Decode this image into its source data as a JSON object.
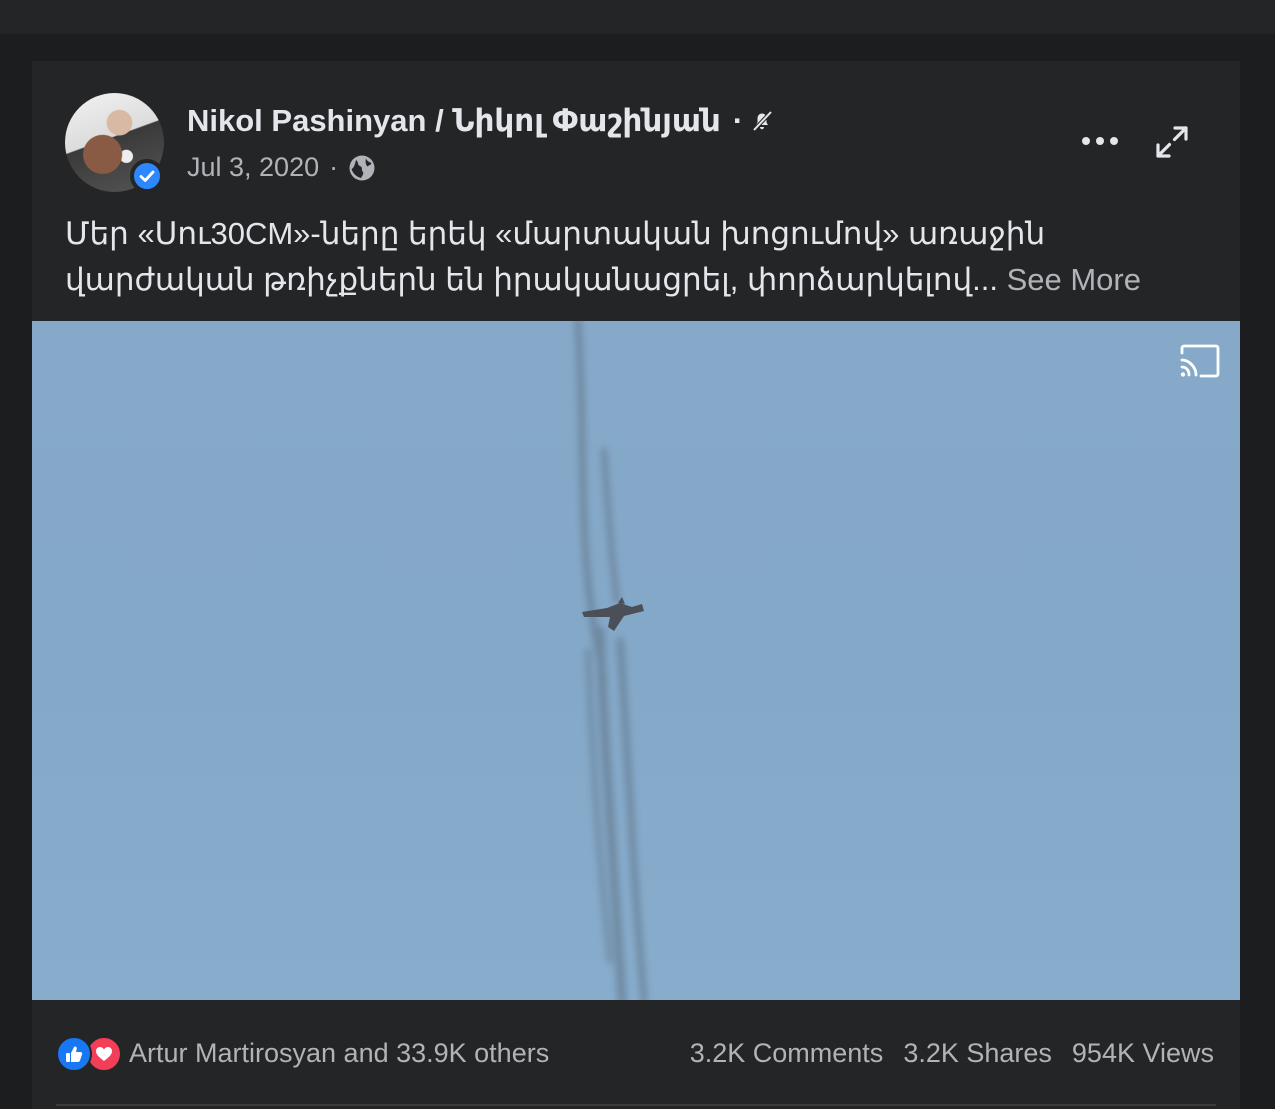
{
  "post": {
    "author": "Nikol Pashinyan / Նիկոլ Փաշինյան",
    "separator": "·",
    "date": "Jul 3, 2020",
    "date_separator": "·",
    "text": "Մեր «Սու30CM»-ները երեկ «մարտական խոցումով» առաջին վարժական թռիչքներն են իրականացրել, փորձարկելով...",
    "see_more_label": "See More"
  },
  "icons": {
    "verified": "verified-badge-icon",
    "notifications_off": "bell-off-icon",
    "audience": "globe-icon",
    "more": "more-dots-icon",
    "expand": "expand-icon",
    "cast": "cast-icon",
    "like": "like-reaction-icon",
    "love": "love-reaction-icon"
  },
  "reactions": {
    "summary": "Artur Martirosyan and 33.9K others"
  },
  "stats": {
    "comments": "3.2K Comments",
    "shares": "3.2K Shares",
    "views": "954K Views"
  },
  "colors": {
    "background": "#1c1d1f",
    "card": "#242527",
    "text_primary": "#e4e6eb",
    "text_secondary": "#b0b3b8",
    "verified_blue": "#2d88ff",
    "like_blue": "#1877f2",
    "love_red": "#f33e58",
    "sky": "#86a9c9"
  }
}
